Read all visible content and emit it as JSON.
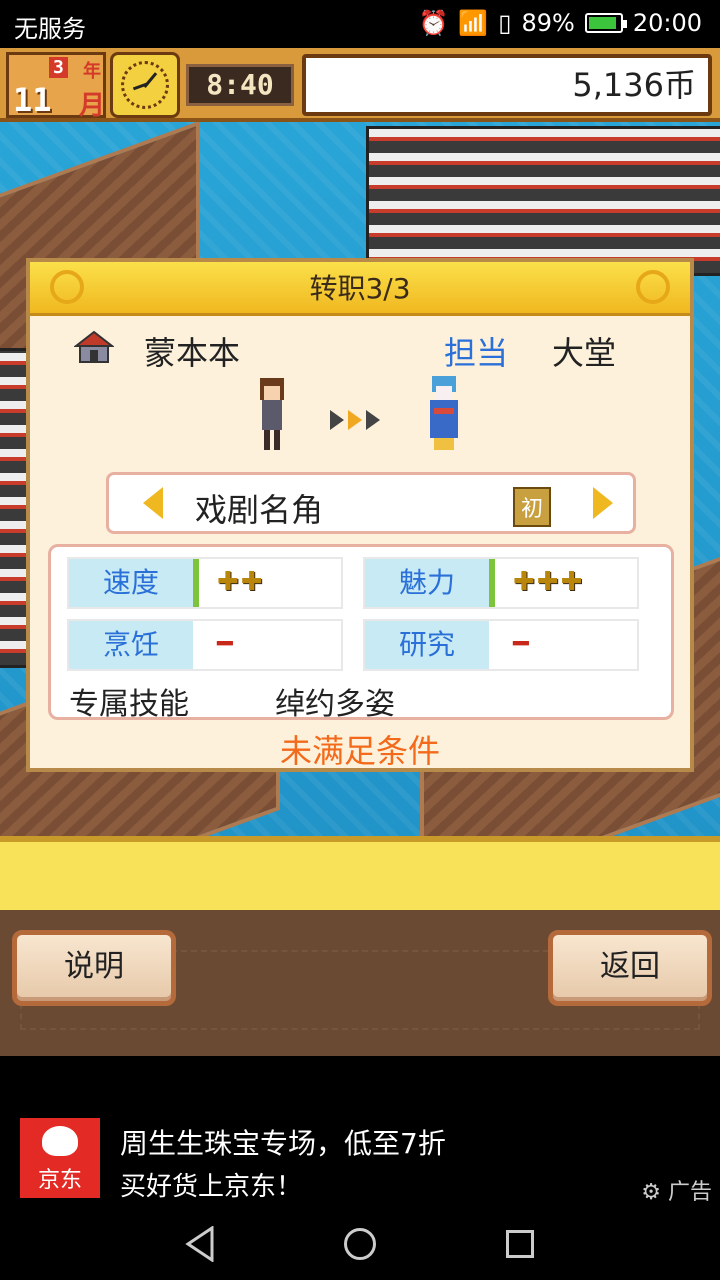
{
  "status_bar": {
    "carrier": "无服务",
    "battery": "89%",
    "battery_level": 0.89,
    "time": "20:00"
  },
  "hud": {
    "year": "3",
    "year_unit": "年",
    "month": "11",
    "month_unit": "月",
    "clock_time": "8:40",
    "coins": "5,136币"
  },
  "dialog": {
    "title": "转职3/3",
    "character_name": "蒙本本",
    "role_label": "担当",
    "role_value": "大堂",
    "job_name": "戏剧名角",
    "job_rank": "初",
    "stats": [
      {
        "label": "速度",
        "value": "✚✚",
        "bar_color": "#7cc43c"
      },
      {
        "label": "魅力",
        "value": "✚✚✚",
        "bar_color": "#7cc43c"
      },
      {
        "label": "烹饪",
        "value": "━",
        "bar_color": ""
      },
      {
        "label": "研究",
        "value": "━",
        "bar_color": ""
      }
    ],
    "skill_label": "专属技能",
    "skill_value": "绰约多姿",
    "condition": "未满足条件"
  },
  "buttons": {
    "help": "说明",
    "back": "返回"
  },
  "ad": {
    "logo_text": "京东",
    "title": "周生生珠宝专场，低至7折",
    "subtitle": "买好货上京东！",
    "tag": "广告"
  },
  "icons": {
    "alarm": "alarm-icon",
    "wifi": "wifi-icon",
    "sim": "sim-icon",
    "battery": "battery-icon"
  }
}
